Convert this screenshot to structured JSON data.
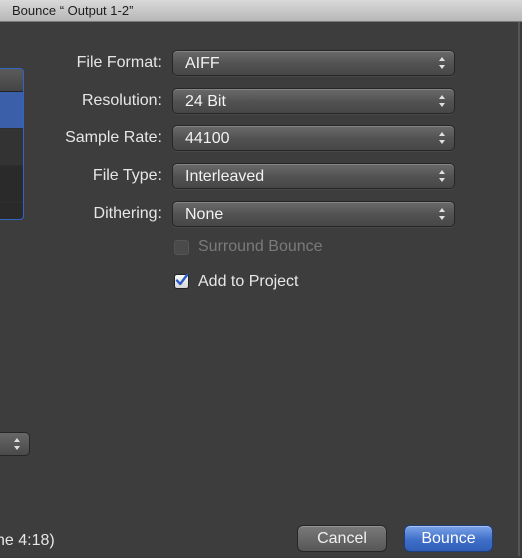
{
  "window": {
    "title": "Bounce “ Output 1-2”"
  },
  "form": {
    "file_format": {
      "label": "File Format:",
      "value": "AIFF"
    },
    "resolution": {
      "label": "Resolution:",
      "value": "24 Bit"
    },
    "sample_rate": {
      "label": "Sample Rate:",
      "value": "44100"
    },
    "file_type": {
      "label": "File Type:",
      "value": "Interleaved"
    },
    "dithering": {
      "label": "Dithering:",
      "value": "None"
    },
    "surround_bounce": {
      "label": "Surround Bounce",
      "checked": false,
      "enabled": false
    },
    "add_to_project": {
      "label": "Add to Project",
      "checked": true,
      "enabled": true
    }
  },
  "status": {
    "text": "ne 4:18)"
  },
  "buttons": {
    "cancel": "Cancel",
    "bounce": "Bounce"
  },
  "colors": {
    "accent": "#3f6fc9",
    "background": "#3d3d3d"
  }
}
